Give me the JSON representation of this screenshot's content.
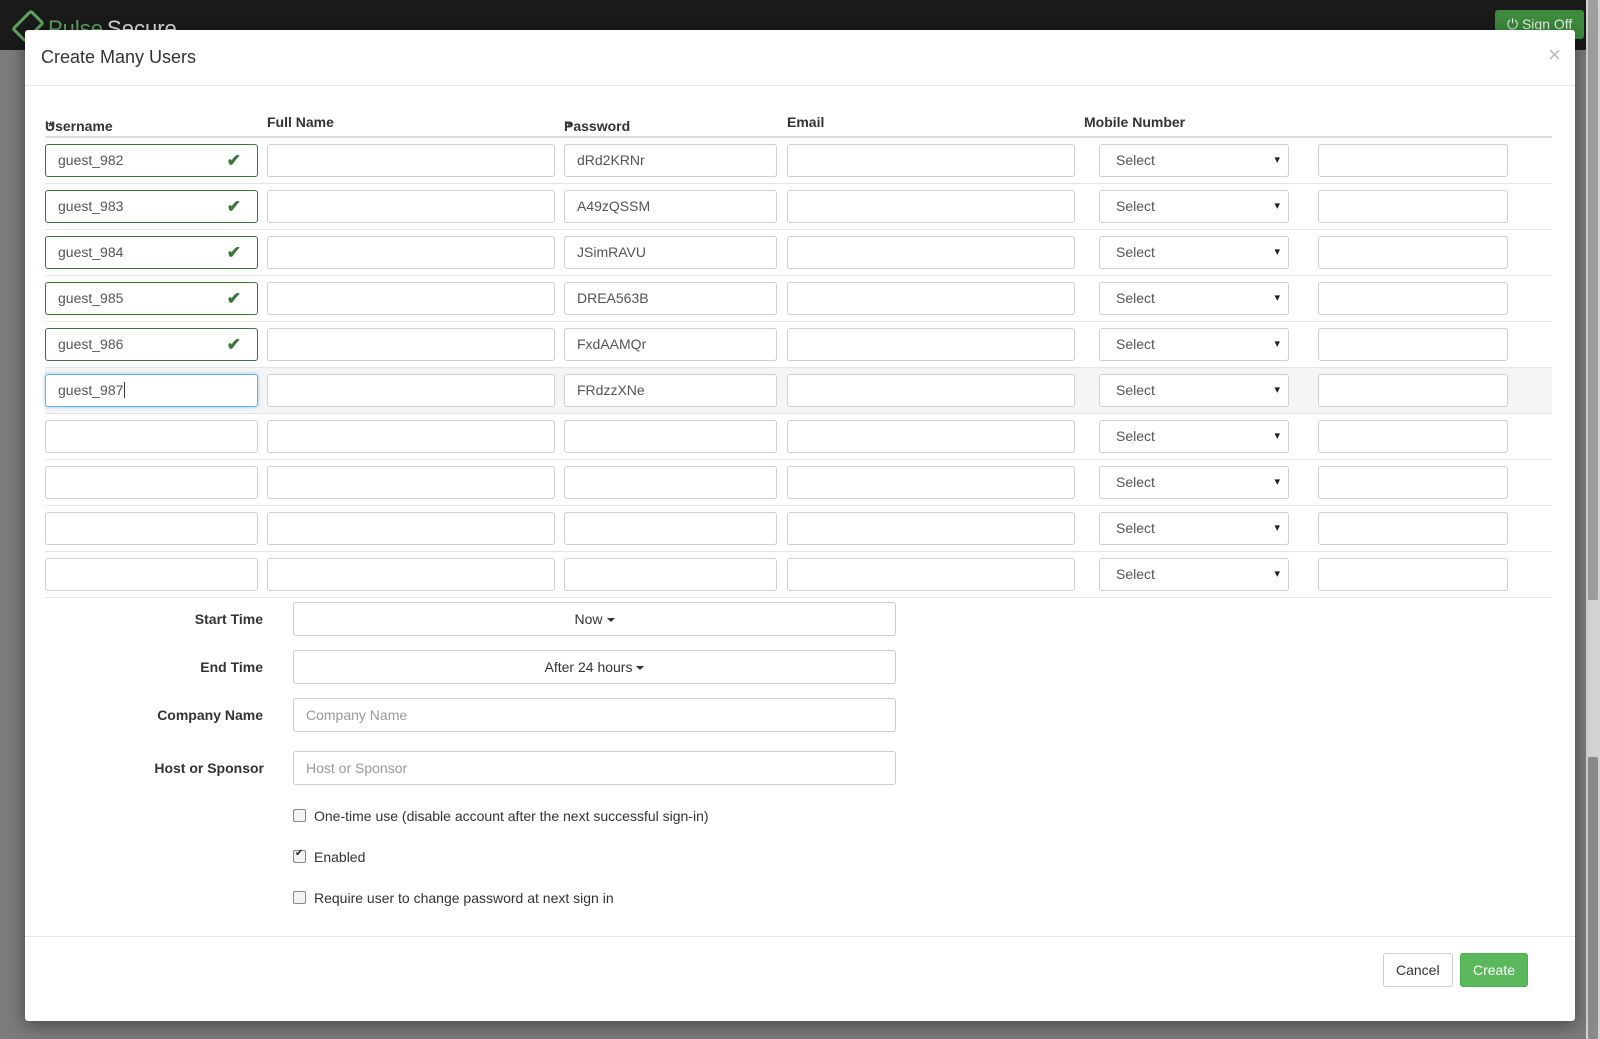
{
  "app": {
    "brand_part1": "Pulse",
    "brand_part2": "Secure",
    "sign_off_label": "Sign Off"
  },
  "modal": {
    "title": "Create Many Users",
    "close_glyph": "×",
    "columns": {
      "username": "Username",
      "full_name": "Full Name",
      "password": "Password",
      "email": "Email",
      "mobile_number": "Mobile Number",
      "required_mark": "*"
    },
    "rows": [
      {
        "username": "guest_982",
        "password": "dRd2KRNr",
        "mobile": "Select",
        "validated": true
      },
      {
        "username": "guest_983",
        "password": "A49zQSSM",
        "mobile": "Select",
        "validated": true
      },
      {
        "username": "guest_984",
        "password": "JSimRAVU",
        "mobile": "Select",
        "validated": true
      },
      {
        "username": "guest_985",
        "password": "DREA563B",
        "mobile": "Select",
        "validated": true
      },
      {
        "username": "guest_986",
        "password": "FxdAAMQr",
        "mobile": "Select",
        "validated": true
      },
      {
        "username": "guest_987",
        "password": "FRdzzXNe",
        "mobile": "Select",
        "validated": false,
        "focused": true
      },
      {
        "username": "",
        "password": "",
        "mobile": "Select",
        "validated": false
      },
      {
        "username": "",
        "password": "",
        "mobile": "Select",
        "validated": false
      },
      {
        "username": "",
        "password": "",
        "mobile": "Select",
        "validated": false
      },
      {
        "username": "",
        "password": "",
        "mobile": "Select",
        "validated": false
      }
    ],
    "check_icon": "✔",
    "select_arrow": "▾",
    "form": {
      "start_time_label": "Start Time",
      "start_time_value": "Now",
      "end_time_label": "End Time",
      "end_time_value": "After 24 hours",
      "company_label": "Company Name",
      "company_placeholder": "Company Name",
      "sponsor_label": "Host or Sponsor",
      "sponsor_placeholder": "Host or Sponsor",
      "one_time_label": "One-time use (disable account after the next successful sign-in)",
      "one_time_checked": false,
      "enabled_label": "Enabled",
      "enabled_checked": true,
      "require_change_label": "Require user to change password at next sign in",
      "require_change_checked": false
    },
    "buttons": {
      "cancel": "Cancel",
      "create": "Create"
    }
  },
  "colors": {
    "success": "#3c763d",
    "create_button": "#5cb85c",
    "required": "#d9534f",
    "focus": "#66afe9"
  }
}
